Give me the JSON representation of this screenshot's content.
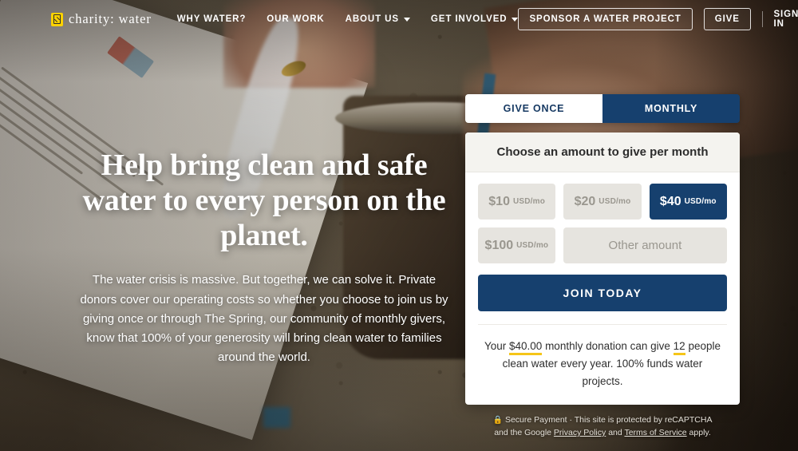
{
  "nav": {
    "logo_text": "charity: water",
    "logo_icon": "jerrycan-icon",
    "links": [
      {
        "label": "WHY WATER?",
        "has_caret": false
      },
      {
        "label": "OUR WORK",
        "has_caret": false
      },
      {
        "label": "ABOUT US",
        "has_caret": true
      },
      {
        "label": "GET INVOLVED",
        "has_caret": true
      }
    ],
    "sponsor_label": "SPONSOR A WATER PROJECT",
    "give_label": "GIVE",
    "signin_label": "SIGN IN"
  },
  "hero": {
    "headline": "Help bring clean and safe water to every person on the planet.",
    "subcopy": "The water crisis is massive. But together, we can solve it. Private donors cover our operating costs so whether you choose to join us by giving once or through The Spring, our community of monthly givers, know that 100% of your generosity will bring clean water to families around the world."
  },
  "donation": {
    "tabs": [
      {
        "label": "GIVE ONCE",
        "active": false
      },
      {
        "label": "MONTHLY",
        "active": true
      }
    ],
    "card_title": "Choose an amount to give per month",
    "amounts": [
      {
        "value": "$10",
        "unit": "USD/mo",
        "selected": false
      },
      {
        "value": "$20",
        "unit": "USD/mo",
        "selected": false
      },
      {
        "value": "$40",
        "unit": "USD/mo",
        "selected": true
      },
      {
        "value": "$100",
        "unit": "USD/mo",
        "selected": false
      }
    ],
    "other_amount_label": "Other amount",
    "cta_label": "JOIN TODAY",
    "impact": {
      "prefix": "Your ",
      "amount": "$40.00",
      "middle": " monthly donation can give ",
      "people": "12",
      "suffix": " people clean water every year. 100% funds water projects."
    },
    "secure": {
      "lock_icon": "lock-icon",
      "line1_a": "Secure Payment · This site is protected by reCAPTCHA",
      "line2_a": "and the Google ",
      "privacy_link": "Privacy Policy",
      "line2_b": " and ",
      "terms_link": "Terms of Service",
      "line2_c": " apply."
    }
  },
  "colors": {
    "navy": "#16406e",
    "highlight_yellow": "#f5c518",
    "logo_yellow": "#ffd200",
    "button_gray": "#e6e4df"
  }
}
